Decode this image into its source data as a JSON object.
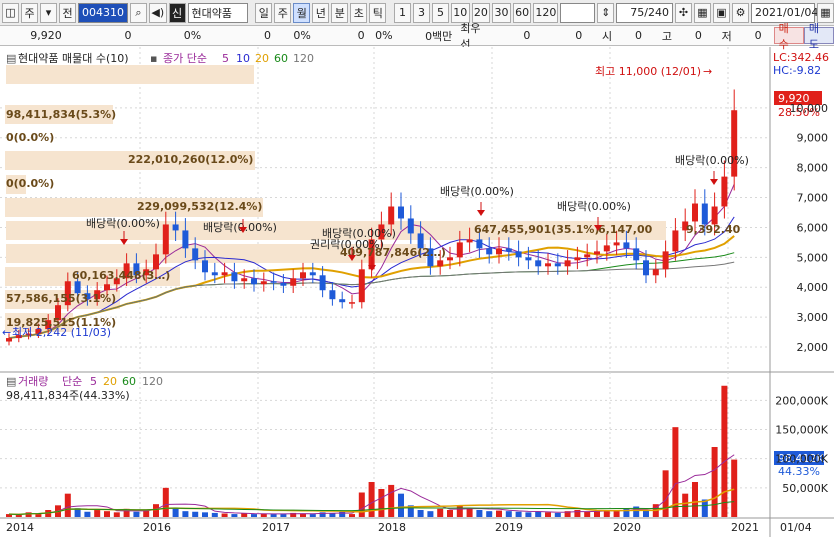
{
  "toolbar": {
    "market": "주",
    "prev": "전",
    "code": "004310",
    "name": "현대약품",
    "periods": [
      "일",
      "주",
      "월",
      "년",
      "분",
      "초",
      "틱"
    ],
    "active_period": "월",
    "nums": [
      "1",
      "3",
      "5",
      "10",
      "20",
      "30",
      "60",
      "120"
    ],
    "count": "75",
    "count_total": "/240",
    "date": "2021/01/04"
  },
  "quote": {
    "price": "9,920",
    "v1": "0",
    "p1": "0%",
    "v2": "0",
    "p2": "0%",
    "v3": "0",
    "p3": "0%",
    "volume_label": "0백만",
    "best_label": "최우선",
    "b1": "0",
    "b2": "0",
    "open_label": "시",
    "open": "0",
    "high_label": "고",
    "high": "0",
    "low_label": "저",
    "low": "0",
    "buy": "매수",
    "sell": "매도"
  },
  "price_panel": {
    "legend_title": "현대약품 매물대 수(10)",
    "legend_ma": "종가 단순",
    "ma_periods": [
      {
        "label": "5",
        "color": "#9a2a9a"
      },
      {
        "label": "10",
        "color": "#2a2ad0"
      },
      {
        "label": "20",
        "color": "#e0a000"
      },
      {
        "label": "60",
        "color": "#1a8a1a"
      },
      {
        "label": "120",
        "color": "#777777"
      }
    ],
    "lc": "LC:342.46",
    "hc": "HC:-9.82",
    "price_tag": "9,920",
    "pct_tag": "28.50%",
    "high_note": "최고 11,000 (12/01)",
    "low_note": "최저 2,242 (11/03)",
    "profile_labels": [
      "98,411,834(5.3%)",
      "0(0.0%)",
      "222,010,260(12.0%)",
      "0(0.0%)",
      "229,099,532(12.4%)",
      "647,455,901(35.1%)",
      "6,147,00",
      "409,787,846(2…)",
      "60,163,448(3…)",
      "57,586,155(3.1%)",
      "19,825,515(1.1%)"
    ],
    "event_labels": [
      "배당락(0.00%)",
      "배당락(0.00%)",
      "배당락(0.00%)",
      "권리락(0.00%)",
      "배당락(0.00%)",
      "배당락(0.00%)",
      "배당락(0.00%)",
      "9,392.40"
    ],
    "y_ticks": [
      "10,000",
      "9,000",
      "8,000",
      "7,000",
      "6,000",
      "5,000",
      "4,000",
      "3,000",
      "2,000"
    ]
  },
  "volume_panel": {
    "legend_title": "거래량",
    "legend_ma": "단순",
    "ma_periods": [
      {
        "label": "5",
        "color": "#9a2a9a"
      },
      {
        "label": "20",
        "color": "#e0a000"
      },
      {
        "label": "60",
        "color": "#1a8a1a"
      },
      {
        "label": "120",
        "color": "#777777"
      }
    ],
    "summary": "98,411,834주(44.33%)",
    "vol_tag": "98,412K",
    "vol_pct": "44.33%",
    "y_ticks": [
      "200,000K",
      "150,000K",
      "100,000K",
      "50,000K"
    ]
  },
  "x_axis": [
    "2014",
    "2016",
    "2017",
    "2018",
    "2019",
    "2020",
    "2021",
    "01/04"
  ],
  "colors": {
    "up": "#e0201a",
    "down": "#1e5ad8",
    "profile": "#f6e4cf",
    "grid": "#d7d7d7"
  },
  "chart_data": {
    "type": "candlestick",
    "y_range": [
      1500,
      11700
    ],
    "monthly_close_approx": [
      2300,
      2400,
      2450,
      2600,
      2900,
      3400,
      4200,
      3800,
      3600,
      3900,
      4100,
      4300,
      4800,
      4400,
      4600,
      5100,
      6100,
      5900,
      5300,
      4900,
      4500,
      4400,
      4500,
      4200,
      4300,
      4100,
      4200,
      4150,
      4050,
      4300,
      4500,
      4400,
      3900,
      3600,
      3500,
      3500,
      4600,
      5600,
      6100,
      6700,
      6300,
      5800,
      5300,
      4700,
      4900,
      5000,
      5500,
      5600,
      5300,
      5100,
      5300,
      5200,
      5000,
      4900,
      4700,
      4800,
      4700,
      4900,
      5000,
      5100,
      5200,
      5400,
      5500,
      5300,
      4900,
      4400,
      4600,
      5200,
      5900,
      6200,
      6800,
      6100,
      6700,
      7700,
      9920
    ],
    "volume_approx": [
      5000,
      4000,
      8000,
      6000,
      12000,
      20000,
      40000,
      15000,
      9000,
      12000,
      10000,
      8000,
      14000,
      9000,
      12000,
      22000,
      50000,
      16000,
      10000,
      9000,
      8000,
      7000,
      6000,
      5000,
      6000,
      5000,
      6000,
      5000,
      5000,
      7000,
      6000,
      5000,
      8000,
      6000,
      9000,
      5000,
      42000,
      60000,
      48000,
      55000,
      40000,
      20000,
      12000,
      10000,
      14000,
      12000,
      20000,
      15000,
      12000,
      10000,
      11000,
      10000,
      9000,
      8000,
      9000,
      8000,
      7000,
      10000,
      12000,
      9000,
      10000,
      12000,
      11000,
      14000,
      18000,
      12000,
      22000,
      80000,
      154000,
      40000,
      60000,
      30000,
      120000,
      225000,
      98412
    ]
  }
}
